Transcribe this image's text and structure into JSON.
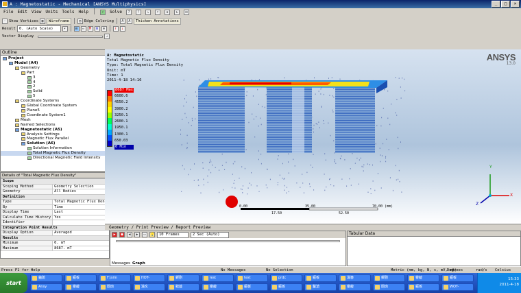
{
  "window": {
    "title": "A : Magnetostatic - Mechanical [ANSYS Multiphysics]",
    "buttons": [
      "_",
      "□",
      "×"
    ]
  },
  "menu": [
    "File",
    "Edit",
    "View",
    "Units",
    "Tools",
    "Help"
  ],
  "toolbar1": {
    "solve": "Solve"
  },
  "toolbar2": {
    "show_vertices": "Show Vertices",
    "wireframe": "Wireframe",
    "edge_coloring": "Edge Coloring",
    "thicken": "Thicken Annotations"
  },
  "toolbar3": {
    "result_label": "Result",
    "result_value": "0. (Auto Scale)"
  },
  "toolbar4": {
    "vector_display": "Vector Display"
  },
  "outline": {
    "title": "Outline",
    "items": [
      {
        "label": "Project",
        "indent": 0,
        "bold": true
      },
      {
        "label": "Model (A4)",
        "indent": 1,
        "bold": true
      },
      {
        "label": "Geometry",
        "indent": 2
      },
      {
        "label": "Part",
        "indent": 3
      },
      {
        "label": "3",
        "indent": 4
      },
      {
        "label": "4",
        "indent": 4
      },
      {
        "label": "2",
        "indent": 4
      },
      {
        "label": "Solid",
        "indent": 4
      },
      {
        "label": "5",
        "indent": 4
      },
      {
        "label": "Coordinate Systems",
        "indent": 2
      },
      {
        "label": "Global Coordinate System",
        "indent": 3
      },
      {
        "label": "Plane5",
        "indent": 3
      },
      {
        "label": "Coordinate System1",
        "indent": 3
      },
      {
        "label": "Mesh",
        "indent": 2
      },
      {
        "label": "Named Selections",
        "indent": 2
      },
      {
        "label": "Magnetostatic (A5)",
        "indent": 2,
        "bold": true
      },
      {
        "label": "Analysis Settings",
        "indent": 3
      },
      {
        "label": "Magnetic Flux Parallel",
        "indent": 3
      },
      {
        "label": "Solution (A6)",
        "indent": 3,
        "bold": true
      },
      {
        "label": "Solution Information",
        "indent": 4
      },
      {
        "label": "Total Magnetic Flux Density",
        "indent": 4
      },
      {
        "label": "Directional Magnetic Field Intensity",
        "indent": 4
      }
    ]
  },
  "details": {
    "title": "Details of \"Total Magnetic Flux Density\"",
    "rows": [
      {
        "section": "Scope"
      },
      {
        "k": "Scoping Method",
        "v": "Geometry Selection"
      },
      {
        "k": "Geometry",
        "v": "All Bodies"
      },
      {
        "section": "Definition"
      },
      {
        "k": "Type",
        "v": "Total Magnetic Flux Density"
      },
      {
        "k": "By",
        "v": "Time"
      },
      {
        "k": "Display Time",
        "v": "Last"
      },
      {
        "k": "Calculate Time History",
        "v": "Yes"
      },
      {
        "k": "Identifier",
        "v": ""
      },
      {
        "section": "Integration Point Results"
      },
      {
        "k": "Display Option",
        "v": "Averaged"
      },
      {
        "section": "Results"
      },
      {
        "k": "Minimum",
        "v": "0. mT"
      },
      {
        "k": "Maximum",
        "v": "8687. mT"
      }
    ]
  },
  "viewport": {
    "header": [
      "A: Magnetostatic",
      "Total Magnetic Flux Density",
      "Type: Total Magnetic Flux Density",
      "Unit: mT",
      "Time: 1",
      "2011-4-18 14:16"
    ],
    "logo": "ANSYS",
    "version": "13.0",
    "legend": {
      "max_label": "8687 Max",
      "values": [
        "6600.6",
        "4550.2",
        "3900.2",
        "3250.1",
        "2600.1",
        "1950.1",
        "1300.1",
        "650.03"
      ],
      "min_label": "0 Min",
      "colors": [
        "#ff0000",
        "#ff7a00",
        "#ffd200",
        "#ffff00",
        "#9aff00",
        "#00ff5a",
        "#00ffd0",
        "#00a8ff",
        "#0050ff",
        "#0000c8"
      ]
    },
    "scale": {
      "labels": [
        "0.00",
        "35.00",
        "70.00 (mm)",
        "17.50",
        "52.50"
      ]
    },
    "triad": {
      "y": "Y",
      "z": "Z",
      "x": "X"
    }
  },
  "tabs": "Geometry / Print Preview / Report Preview",
  "animation": {
    "frames": "10 Frames",
    "time": "2 Sec (Auto)"
  },
  "bottom_tabs": [
    "Messages",
    "Graph"
  ],
  "tabular": "Tabular Data",
  "status": {
    "help": "Press F1 for Help",
    "messages": "No Messages",
    "selection": "No Selection",
    "units": "Metric (mm, kg, N, s, mV, mA)",
    "degrees": "Degrees",
    "rad": "rad/s",
    "celsius": "Celsius"
  },
  "taskbar": {
    "start": "start",
    "buttons": [
      "鏀鹃",
      "鏂板",
      "F:\\sim",
      "HOT-",
      "鍥剧",
      "Iest",
      "test",
      "prdc",
      "鏂板",
      "瀹簭",
      "鍥剧",
      "鐢靛",
      "鏂板",
      "Ansy",
      "鐢靛",
      "閲囪",
      "瀹夊",
      "鎴戠",
      "鐢靛",
      "鏂板",
      "鏂板",
      "鑿滄",
      "鐢靛",
      "閲囪",
      "鏂板",
      "WOT-"
    ],
    "time": "15:33",
    "date": "2011-4-18"
  }
}
